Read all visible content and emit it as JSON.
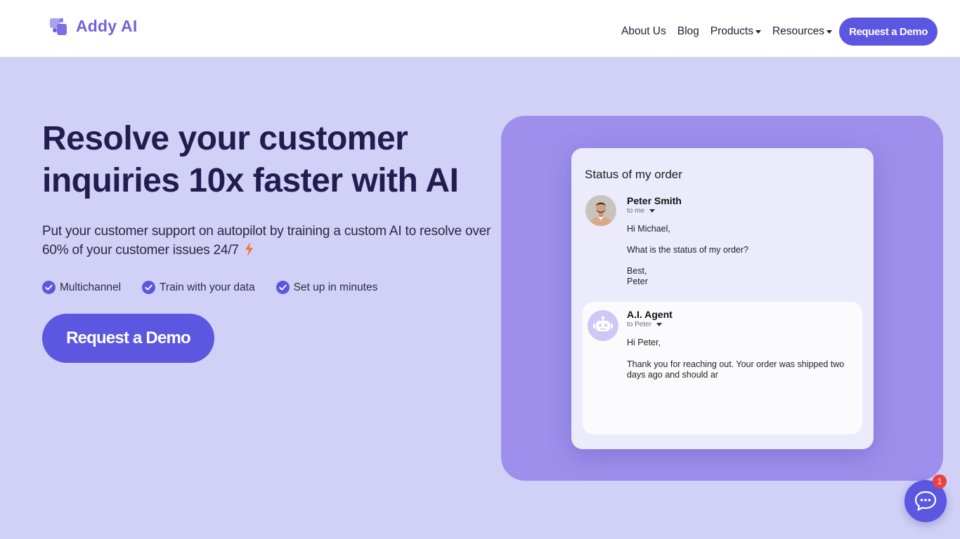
{
  "brand": {
    "name": "Addy AI"
  },
  "nav": {
    "links": [
      {
        "label": "About Us"
      },
      {
        "label": "Blog"
      },
      {
        "label": "Products"
      },
      {
        "label": "Resources"
      }
    ],
    "cta_label": "Request a Demo"
  },
  "hero": {
    "title_line1": "Resolve your customer",
    "title_line2": "inquiries 10x faster with AI",
    "subtitle": "Put your customer support on autopilot by training a custom AI to resolve over 60% of your customer issues 24/7",
    "features": [
      {
        "label": "Multichannel"
      },
      {
        "label": "Train with your data"
      },
      {
        "label": "Set up in minutes"
      }
    ],
    "cta_label": "Request a Demo"
  },
  "email_card": {
    "title": "Status of my order",
    "incoming": {
      "sender": "Peter Smith",
      "to": "to me",
      "greeting": "Hi Michael,",
      "body": "What is the status of my order?",
      "signoff": "Best,",
      "signature": "Peter"
    },
    "reply": {
      "sender": "A.I. Agent",
      "to": "to Peter",
      "greeting": "Hi Peter,",
      "body": "Thank you for reaching out. Your order was shipped two days ago and should ar"
    }
  },
  "chat_widget": {
    "badge_count": "1"
  },
  "colors": {
    "accent": "#5b57e0",
    "hero_background": "#d1d0f6",
    "panel": "#9e8fec",
    "title_text": "#231c4f",
    "badge": "#ef3e3e"
  },
  "icons": [
    "logo-mark",
    "caret-down",
    "check-circle",
    "lightning-bolt",
    "user-avatar",
    "robot-avatar",
    "chat-bubble"
  ]
}
